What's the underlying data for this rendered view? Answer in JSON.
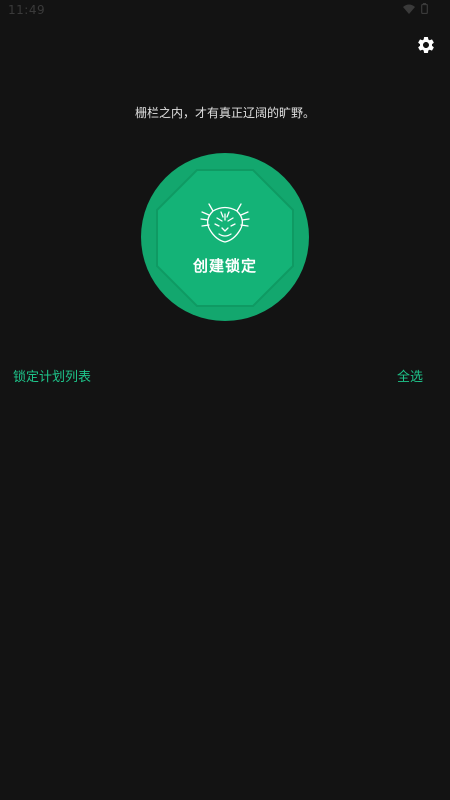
{
  "status_bar": {
    "time": "11:49",
    "icons": [
      "wifi-icon",
      "battery-icon"
    ]
  },
  "toolbar": {
    "settings_icon": "gear-icon"
  },
  "slogan": "栅栏之内，才有真正辽阔的旷野。",
  "lock_button": {
    "label": "创建锁定",
    "icon": "tiger-icon"
  },
  "list": {
    "title": "锁定计划列表",
    "select_all_label": "全选"
  },
  "colors": {
    "background": "#131313",
    "accent": "#13a76e",
    "accent_dark": "#0f9a63",
    "accent_text": "#1ec48a"
  }
}
